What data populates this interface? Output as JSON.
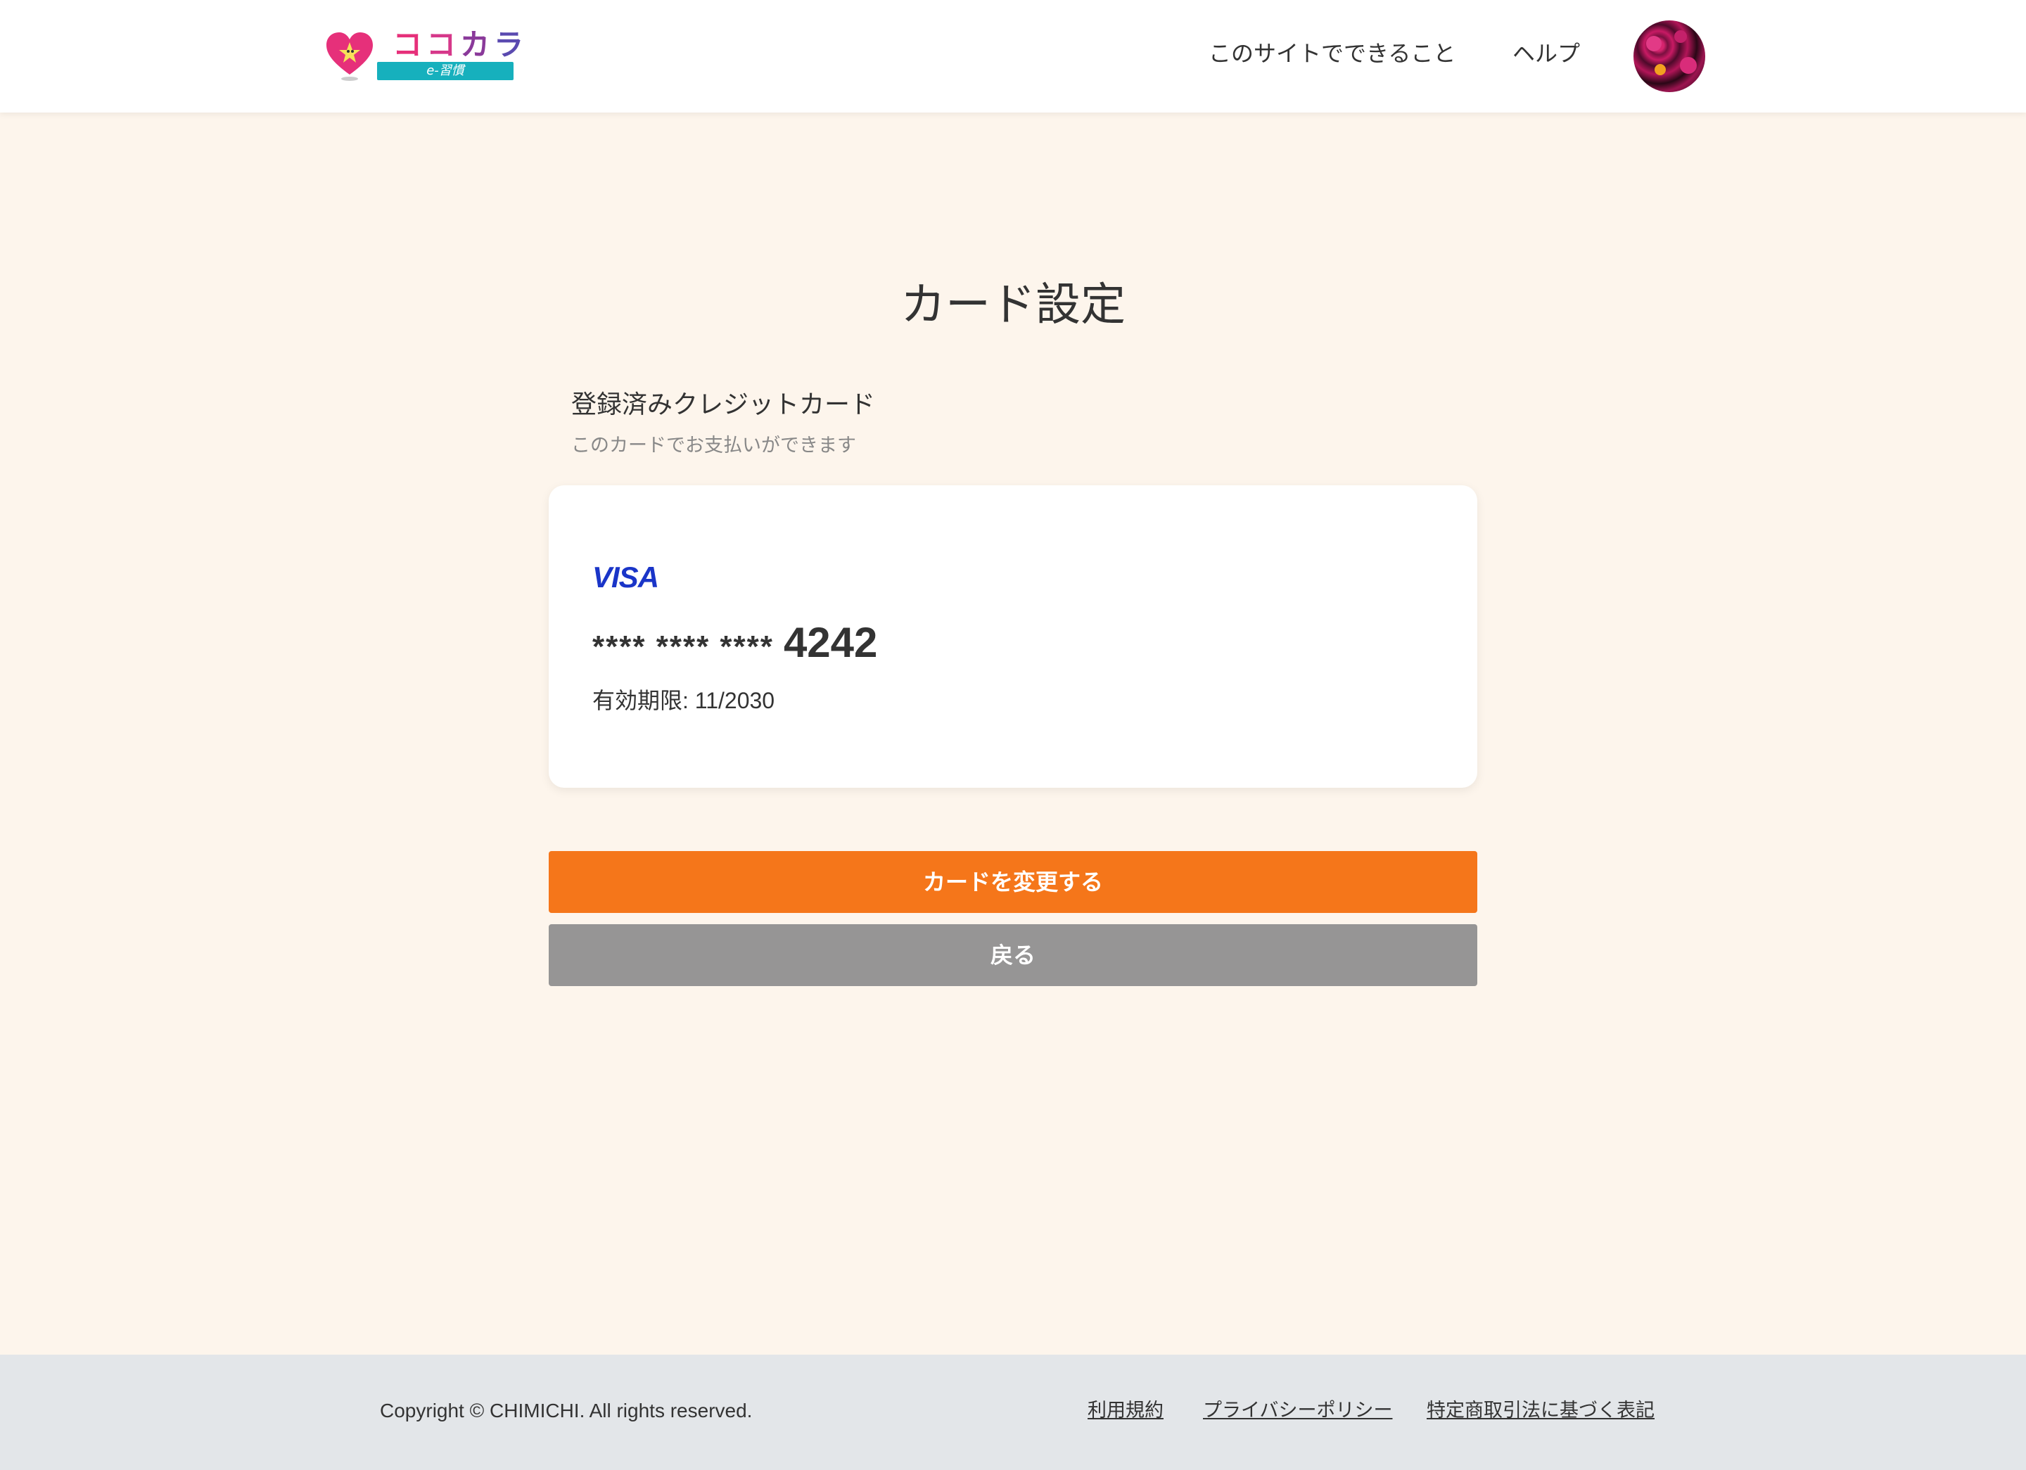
{
  "header": {
    "logo": {
      "word": [
        "コ",
        "コ",
        "カ",
        "ラ"
      ],
      "tagline": "e-習慣"
    },
    "nav": {
      "features_label": "このサイトでできること",
      "help_label": "ヘルプ"
    }
  },
  "main": {
    "title": "カード設定",
    "section_title": "登録済みクレジットカード",
    "section_subtitle": "このカードでお支払いができます",
    "card": {
      "brand": "VISA",
      "masked_number": "**** **** ****",
      "last4": "4242",
      "expiry": "有効期限: 11/2030"
    },
    "buttons": {
      "change_label": "カードを変更する",
      "back_label": "戻る"
    }
  },
  "footer": {
    "copyright": "Copyright © CHIMICHI. All rights reserved.",
    "links": {
      "terms": "利用規約",
      "privacy": "プライバシーポリシー",
      "tokusho": "特定商取引法に基づく表記"
    }
  },
  "colors": {
    "accent_orange": "#f5761a",
    "back_gray": "#969595",
    "visa_blue": "#1a35c8",
    "page_bg": "#fdf5ec",
    "footer_bg": "#e3e6e9",
    "logo_teal": "#16b0bd",
    "logo_pink": "#e6307a"
  }
}
